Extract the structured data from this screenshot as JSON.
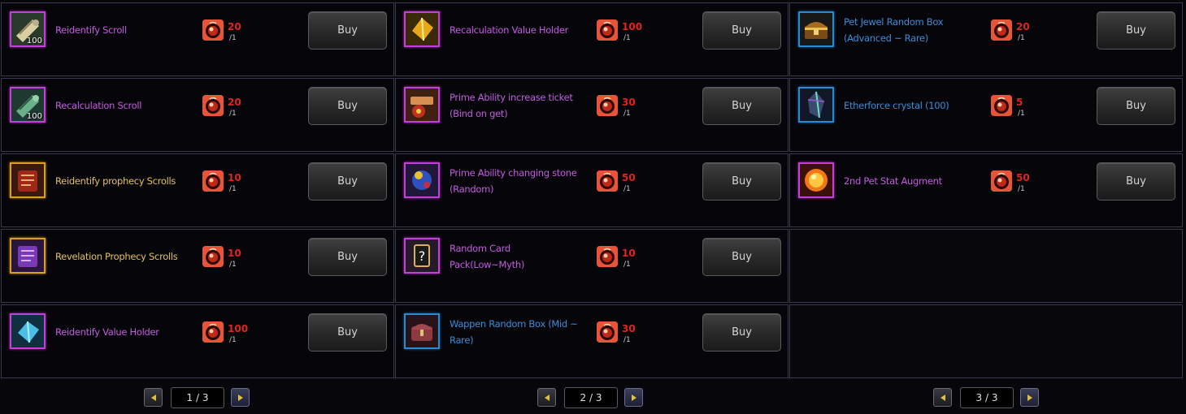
{
  "colors": {
    "name_purple": "#c25ce0",
    "name_gold": "#e2c15a",
    "name_blue": "#3a8ed8",
    "price_red": "#e0261c",
    "background": "#07060b"
  },
  "buy_label": "Buy",
  "pages": [
    {
      "indicator": "1 / 3",
      "items": [
        {
          "name": "Reidentify Scroll",
          "name_color": "purple",
          "frame": "purple",
          "icon": "scroll-icon",
          "qty": "100",
          "price": "20",
          "limit": "/1"
        },
        {
          "name": "Recalculation Scroll",
          "name_color": "purple",
          "frame": "purple",
          "icon": "scroll-green-icon",
          "qty": "100",
          "price": "20",
          "limit": "/1"
        },
        {
          "name": "Reidentify prophecy Scrolls",
          "name_color": "gold",
          "frame": "gold",
          "icon": "prophecy-book-red-icon",
          "qty": "",
          "price": "10",
          "limit": "/1"
        },
        {
          "name": "Revelation Prophecy Scrolls",
          "name_color": "gold",
          "frame": "gold",
          "icon": "prophecy-book-purple-icon",
          "qty": "",
          "price": "10",
          "limit": "/1"
        },
        {
          "name": "Reidentify Value Holder",
          "name_color": "purple",
          "frame": "purple",
          "icon": "crystal-holder-icon",
          "qty": "",
          "price": "100",
          "limit": "/1"
        }
      ]
    },
    {
      "indicator": "2 / 3",
      "items": [
        {
          "name": "Recalculation Value Holder",
          "name_color": "purple",
          "frame": "purple",
          "icon": "gold-holder-icon",
          "qty": "",
          "price": "100",
          "limit": "/1"
        },
        {
          "name": "Prime Ability increase ticket (Bind on get)",
          "name_color": "purple",
          "frame": "purple",
          "icon": "ticket-icon",
          "qty": "",
          "price": "30",
          "limit": "/1"
        },
        {
          "name": "Prime Ability changing stone (Random)",
          "name_color": "purple",
          "frame": "purple",
          "icon": "gem-stone-icon",
          "qty": "",
          "price": "50",
          "limit": "/1"
        },
        {
          "name": "Random Card Pack(Low~Myth)",
          "name_color": "purple",
          "frame": "purple",
          "icon": "card-pack-icon",
          "qty": "",
          "price": "10",
          "limit": "/1"
        },
        {
          "name": "Wappen Random Box (Mid ~ Rare)",
          "name_color": "blue",
          "frame": "blue",
          "icon": "wappen-box-icon",
          "qty": "",
          "price": "30",
          "limit": "/1"
        }
      ]
    },
    {
      "indicator": "3 / 3",
      "items": [
        {
          "name": "Pet Jewel Random Box (Advanced ~ Rare)",
          "name_color": "blue",
          "frame": "blue",
          "icon": "treasure-chest-icon",
          "qty": "",
          "price": "20",
          "limit": "/1"
        },
        {
          "name": "Etherforce crystal (100)",
          "name_color": "blue",
          "frame": "blue",
          "icon": "ether-crystal-icon",
          "qty": "",
          "price": "5",
          "limit": "/1"
        },
        {
          "name": "2nd Pet Stat Augment",
          "name_color": "purple",
          "frame": "purple",
          "icon": "sun-orb-icon",
          "qty": "",
          "price": "50",
          "limit": "/1"
        }
      ]
    }
  ]
}
